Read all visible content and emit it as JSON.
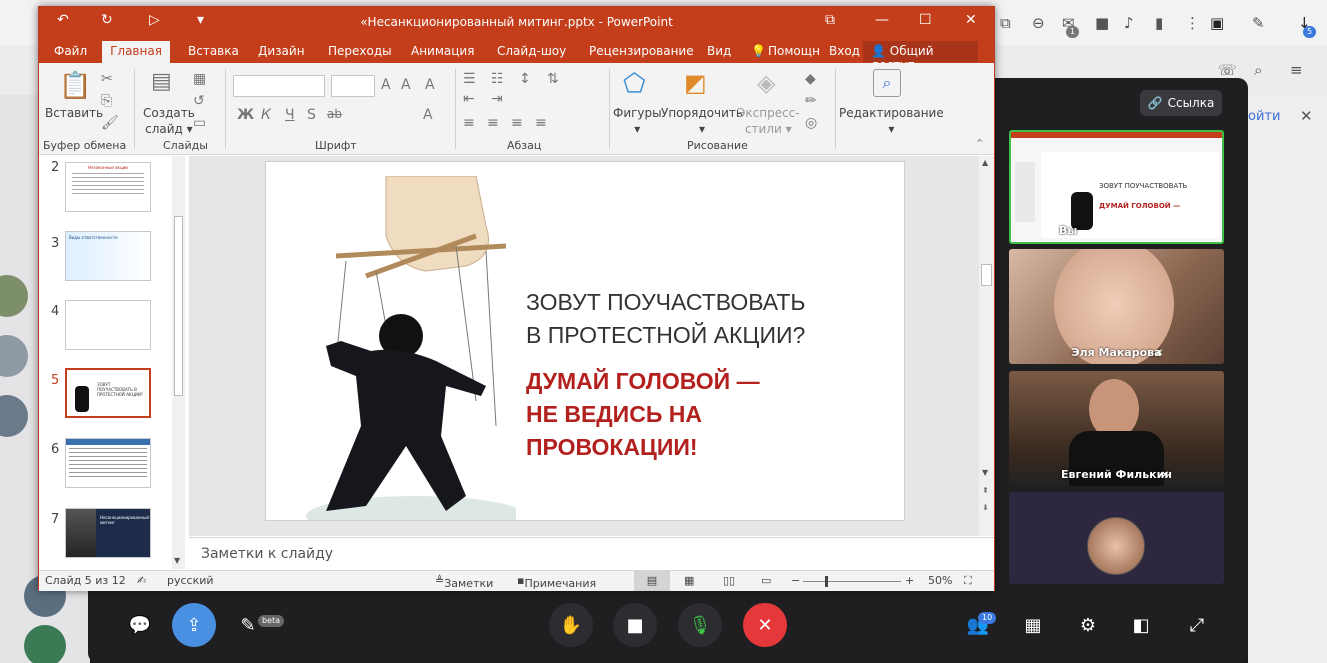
{
  "ppt": {
    "window_title": "«Несанкционированный митинг.pptx - PowerPoint",
    "tabs": [
      "Файл",
      "Главная",
      "Вставка",
      "Дизайн",
      "Переходы",
      "Анимация",
      "Слайд-шоу",
      "Рецензирование",
      "Вид"
    ],
    "help": "Помощн",
    "signin": "Вход",
    "share": "Общий доступ",
    "ribbon": {
      "paste": "Вставить",
      "new_slide_1": "Создать",
      "new_slide_2": "слайд",
      "shapes": "Фигуры",
      "arrange": "Упорядочить",
      "styles_1": "Экспресс-",
      "styles_2": "стили",
      "editing": "Редактирование",
      "font_buttons": [
        "Ж",
        "К",
        "Ч",
        "S",
        "ab",
        "A"
      ],
      "groups": [
        "Буфер обмена",
        "Слайды",
        "Шрифт",
        "Абзац",
        "Рисование"
      ]
    },
    "thumbnails": [
      {
        "num": "2",
        "title": "Незаконные акции"
      },
      {
        "num": "3",
        "title": "Виды ответственности"
      },
      {
        "num": "4",
        "title": ""
      },
      {
        "num": "5",
        "title": "ЗОВУТ ПОУЧАСТВОВАТЬ В ПРОТЕСТНОЙ АКЦИИ?"
      },
      {
        "num": "6",
        "title": ""
      },
      {
        "num": "7",
        "title": "Несанкционированный митинг"
      }
    ],
    "slide": {
      "line1": "ЗОВУТ ПОУЧАСТВОВАТЬ",
      "line2": "В ПРОТЕСТНОЙ АКЦИИ?",
      "line3": "ДУМАЙ ГОЛОВОЙ —",
      "line4": "НЕ ВЕДИСЬ НА",
      "line5": "ПРОВОКАЦИИ!",
      "dark_color": "#333333",
      "accent_color": "#b3211f"
    },
    "notes_placeholder": "Заметки к слайду",
    "status": {
      "slide_of": "Слайд 5 из 12",
      "language": "русский",
      "notes": "Заметки",
      "comments": "Примечания",
      "zoom": "50%"
    }
  },
  "call": {
    "link_button": "Ссылка",
    "you_label": "Вы",
    "participants": [
      {
        "name": "Эля Макарова"
      },
      {
        "name": "Евгений Филькин"
      }
    ],
    "pen_badge": "beta",
    "people_count": "10",
    "chat_badge": "5",
    "messages_badge": "1",
    "end_call_color": "#e5383b",
    "share_color": "#4a90e2",
    "bg_link_text": "ойти"
  }
}
